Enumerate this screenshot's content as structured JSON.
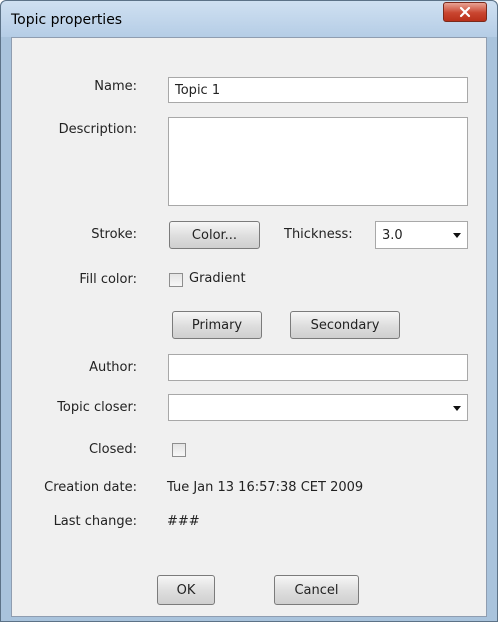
{
  "window": {
    "title": "Topic properties"
  },
  "labels": {
    "name": "Name:",
    "description": "Description:",
    "stroke": "Stroke:",
    "thickness": "Thickness:",
    "fill_color": "Fill color:",
    "author": "Author:",
    "topic_closer": "Topic closer:",
    "closed": "Closed:",
    "creation_date": "Creation date:",
    "last_change": "Last change:"
  },
  "fields": {
    "name": "Topic 1",
    "description": "",
    "thickness": "3.0",
    "author": "",
    "topic_closer": "",
    "creation_date": "Tue Jan 13 16:57:38 CET 2009",
    "last_change": "###"
  },
  "buttons": {
    "color": "Color...",
    "gradient": "Gradient",
    "primary": "Primary",
    "secondary": "Secondary",
    "ok": "OK",
    "cancel": "Cancel"
  },
  "checkboxes": {
    "gradient_checked": false,
    "closed_checked": false
  },
  "colors": {
    "window_frame": "#a9c3dc",
    "close_button": "#c9452f",
    "client": "#f0f0f0"
  }
}
